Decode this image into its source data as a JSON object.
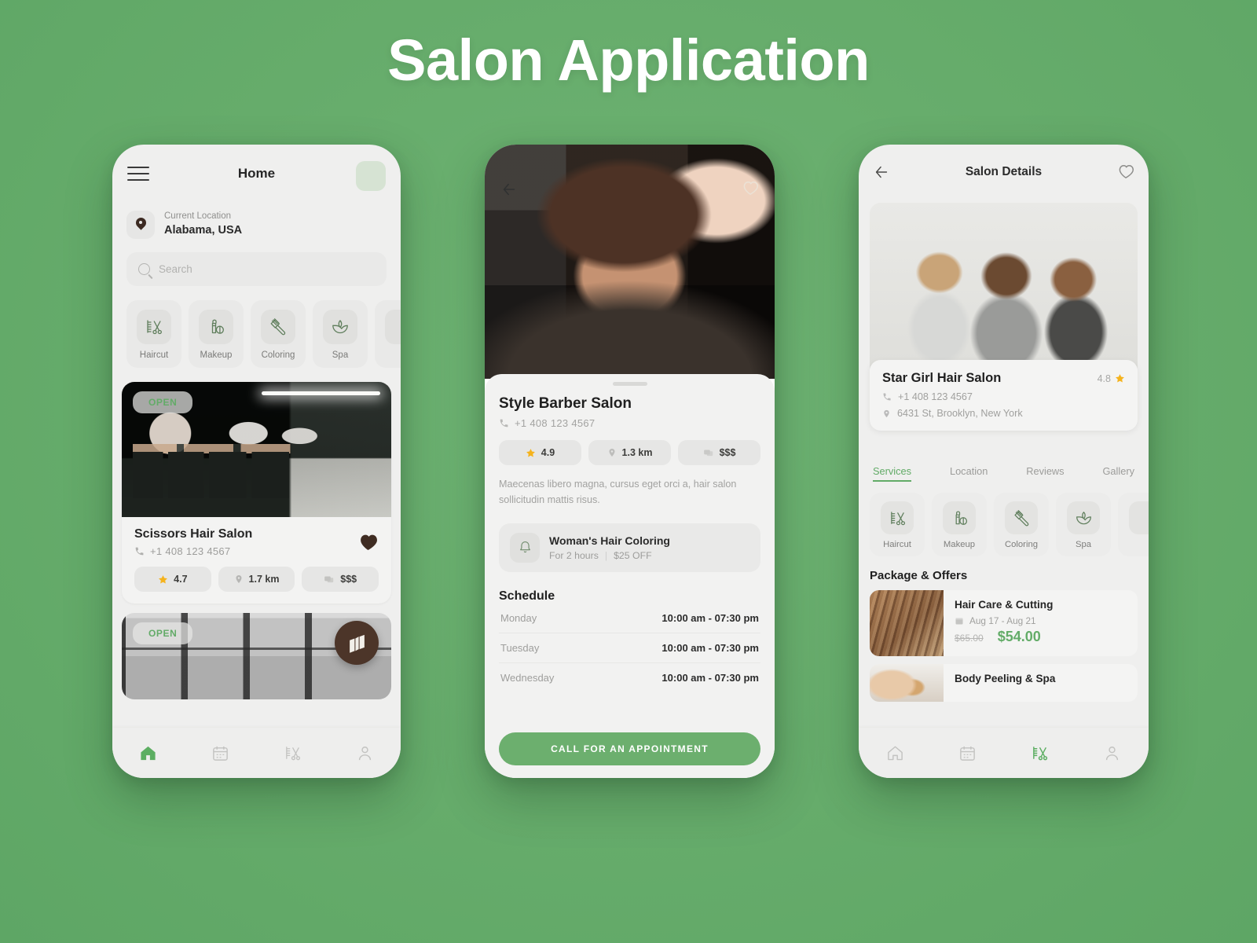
{
  "page": {
    "title": "Salon Application",
    "background_color": "#66ac6b",
    "accent_color": "#63ac68"
  },
  "phone1": {
    "header": {
      "title": "Home",
      "menu_icon": "hamburger-menu-icon",
      "avatar_icon": "avatar-placeholder"
    },
    "location": {
      "label": "Current Location",
      "value": "Alabama, USA",
      "icon": "map-pin-icon"
    },
    "search": {
      "placeholder": "Search",
      "icon": "search-icon"
    },
    "categories": [
      {
        "label": "Haircut",
        "icon": "haircut-scissors-comb-icon"
      },
      {
        "label": "Makeup",
        "icon": "makeup-lipstick-icon"
      },
      {
        "label": "Coloring",
        "icon": "coloring-brush-icon"
      },
      {
        "label": "Spa",
        "icon": "spa-lotus-icon"
      }
    ],
    "cards": [
      {
        "badge": "OPEN",
        "name": "Scissors Hair Salon",
        "phone": "+1 408 123 4567",
        "favorite": true,
        "rating": "4.7",
        "distance": "1.7 km",
        "price": "$$$"
      },
      {
        "badge": "OPEN"
      }
    ],
    "map_fab": "map-icon",
    "tabbar": [
      {
        "icon": "home-icon",
        "active": true
      },
      {
        "icon": "calendar-icon",
        "active": false
      },
      {
        "icon": "scissors-comb-icon",
        "active": false
      },
      {
        "icon": "profile-person-icon",
        "active": false
      }
    ]
  },
  "phone2": {
    "back_icon": "back-arrow-icon",
    "favorite_icon": "heart-outline-icon",
    "name": "Style Barber Salon",
    "phone": "+1 408 123 4567",
    "stats": {
      "rating": "4.9",
      "distance": "1.3 km",
      "price": "$$$"
    },
    "description": "Maecenas libero magna, cursus eget orci a, hair salon sollicitudin mattis risus.",
    "offer": {
      "icon": "bell-icon",
      "title": "Woman's Hair Coloring",
      "duration": "For 2 hours",
      "discount": "$25 OFF"
    },
    "schedule_heading": "Schedule",
    "schedule": [
      {
        "day": "Monday",
        "hours": "10:00 am - 07:30 pm"
      },
      {
        "day": "Tuesday",
        "hours": "10:00 am - 07:30 pm"
      },
      {
        "day": "Wednesday",
        "hours": "10:00 am - 07:30 pm"
      }
    ],
    "cta": "CALL FOR AN APPOINTMENT"
  },
  "phone3": {
    "header": {
      "title": "Salon Details",
      "back_icon": "back-arrow-icon",
      "favorite_icon": "heart-outline-icon"
    },
    "info": {
      "name": "Star Girl Hair Salon",
      "rating": "4.8",
      "phone": "+1 408 123 4567",
      "address": "6431 St, Brooklyn, New York"
    },
    "tabs": [
      {
        "label": "Services",
        "active": true
      },
      {
        "label": "Location",
        "active": false
      },
      {
        "label": "Reviews",
        "active": false
      },
      {
        "label": "Gallery",
        "active": false
      }
    ],
    "categories": [
      {
        "label": "Haircut",
        "icon": "haircut-scissors-comb-icon"
      },
      {
        "label": "Makeup",
        "icon": "makeup-lipstick-icon"
      },
      {
        "label": "Coloring",
        "icon": "coloring-brush-icon"
      },
      {
        "label": "Spa",
        "icon": "spa-lotus-icon"
      }
    ],
    "packages_heading": "Package & Offers",
    "packages": [
      {
        "title": "Hair Care & Cutting",
        "date": "Aug 17 - Aug 21",
        "old_price": "$65.00",
        "new_price": "$54.00"
      },
      {
        "title": "Body Peeling & Spa"
      }
    ],
    "tabbar": [
      {
        "icon": "home-icon",
        "active": false
      },
      {
        "icon": "calendar-icon",
        "active": false
      },
      {
        "icon": "scissors-comb-icon",
        "active": true
      },
      {
        "icon": "profile-person-icon",
        "active": false
      }
    ]
  }
}
